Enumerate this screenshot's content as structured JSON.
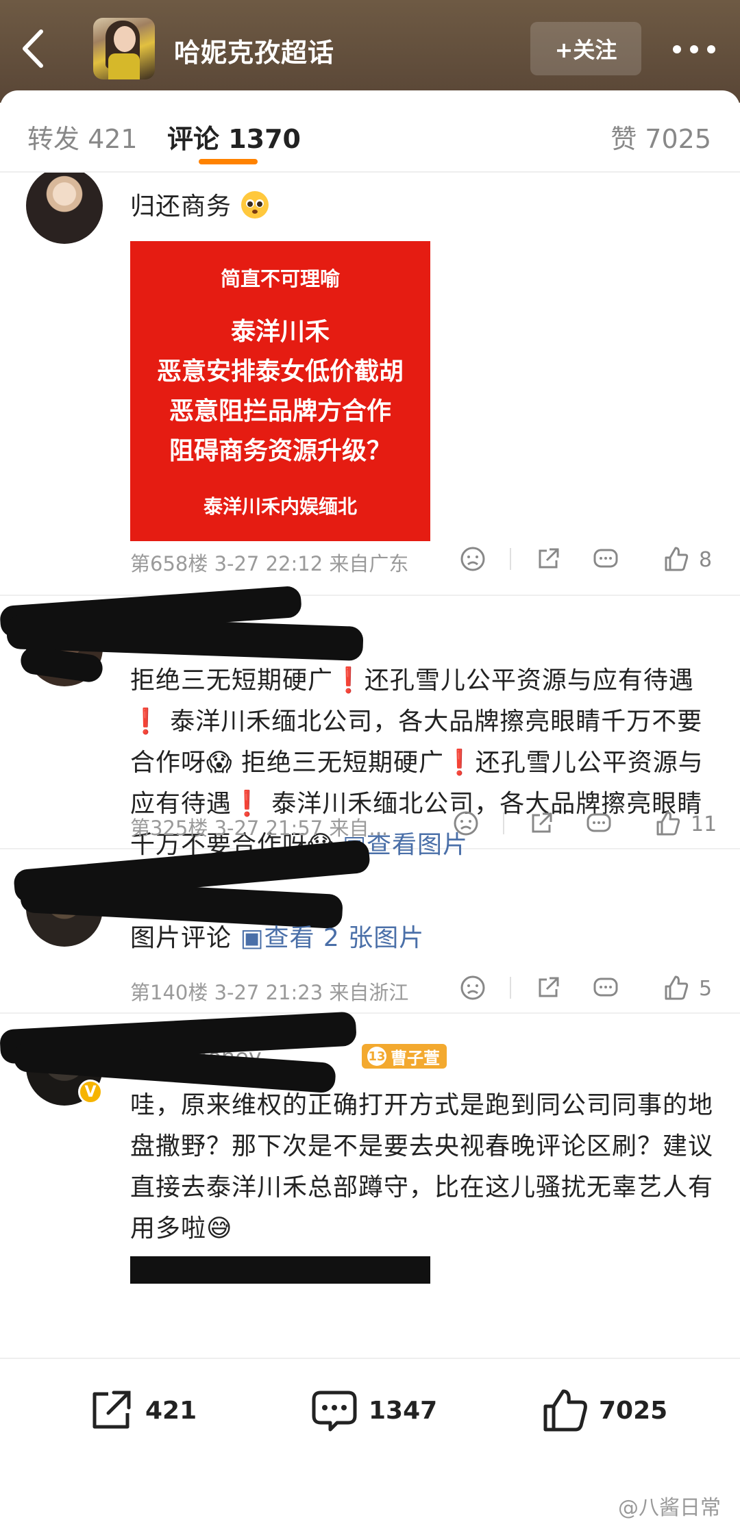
{
  "header": {
    "title": "哈妮克孜超话",
    "follow_label": "+关注",
    "icons": [
      "back-arrow-icon",
      "more-icon"
    ]
  },
  "tabs": {
    "repost": "转发 421",
    "comment": "评论 1370",
    "like": "赞 7025"
  },
  "comments": [
    {
      "text": "归还商务",
      "emoji": "pleading-face",
      "image": {
        "line1": "简直不可理喻",
        "line2": "泰洋川禾",
        "line3": "恶意安排泰女低价截胡",
        "line4": "恶意阻拦品牌方合作",
        "line5": "阻碍商务资源升级？",
        "line6": "泰洋川禾内娱缅北"
      },
      "meta": "第658楼 3-27 22:12 来自广东",
      "likes": "8"
    },
    {
      "text": "拒绝三无短期硬广❗️还孔雪儿公平资源与应有待遇❗️ 泰洋川禾缅北公司，各大品牌擦亮眼睛千万不要合作呀😱 拒绝三无短期硬广❗️还孔雪儿公平资源与应有待遇❗️ 泰洋川禾缅北公司，各大品牌擦亮眼睛千万不要合作呀😱",
      "link": "查看图片",
      "meta": "第325楼 3-27 21:57 来自...",
      "likes": "11"
    },
    {
      "text": "图片评论",
      "link": "查看 2 张图片",
      "meta": "第140楼 3-27 21:23 来自浙江",
      "likes": "5"
    },
    {
      "username": "zhan_honey",
      "fan_badge": "曹子萱",
      "fan_level": "13",
      "text": "哇，原来维权的正确打开方式是跑到同公司同事的地盘撒野？那下次是不是要去央视春晚评论区刷？建议直接去泰洋川禾总部蹲守，比在这儿骚扰无辜艺人有用多啦😅"
    }
  ],
  "bottom_bar": {
    "repost_count": "421",
    "comment_count": "1347",
    "like_count": "7025"
  },
  "watermark": "@八酱日常"
}
